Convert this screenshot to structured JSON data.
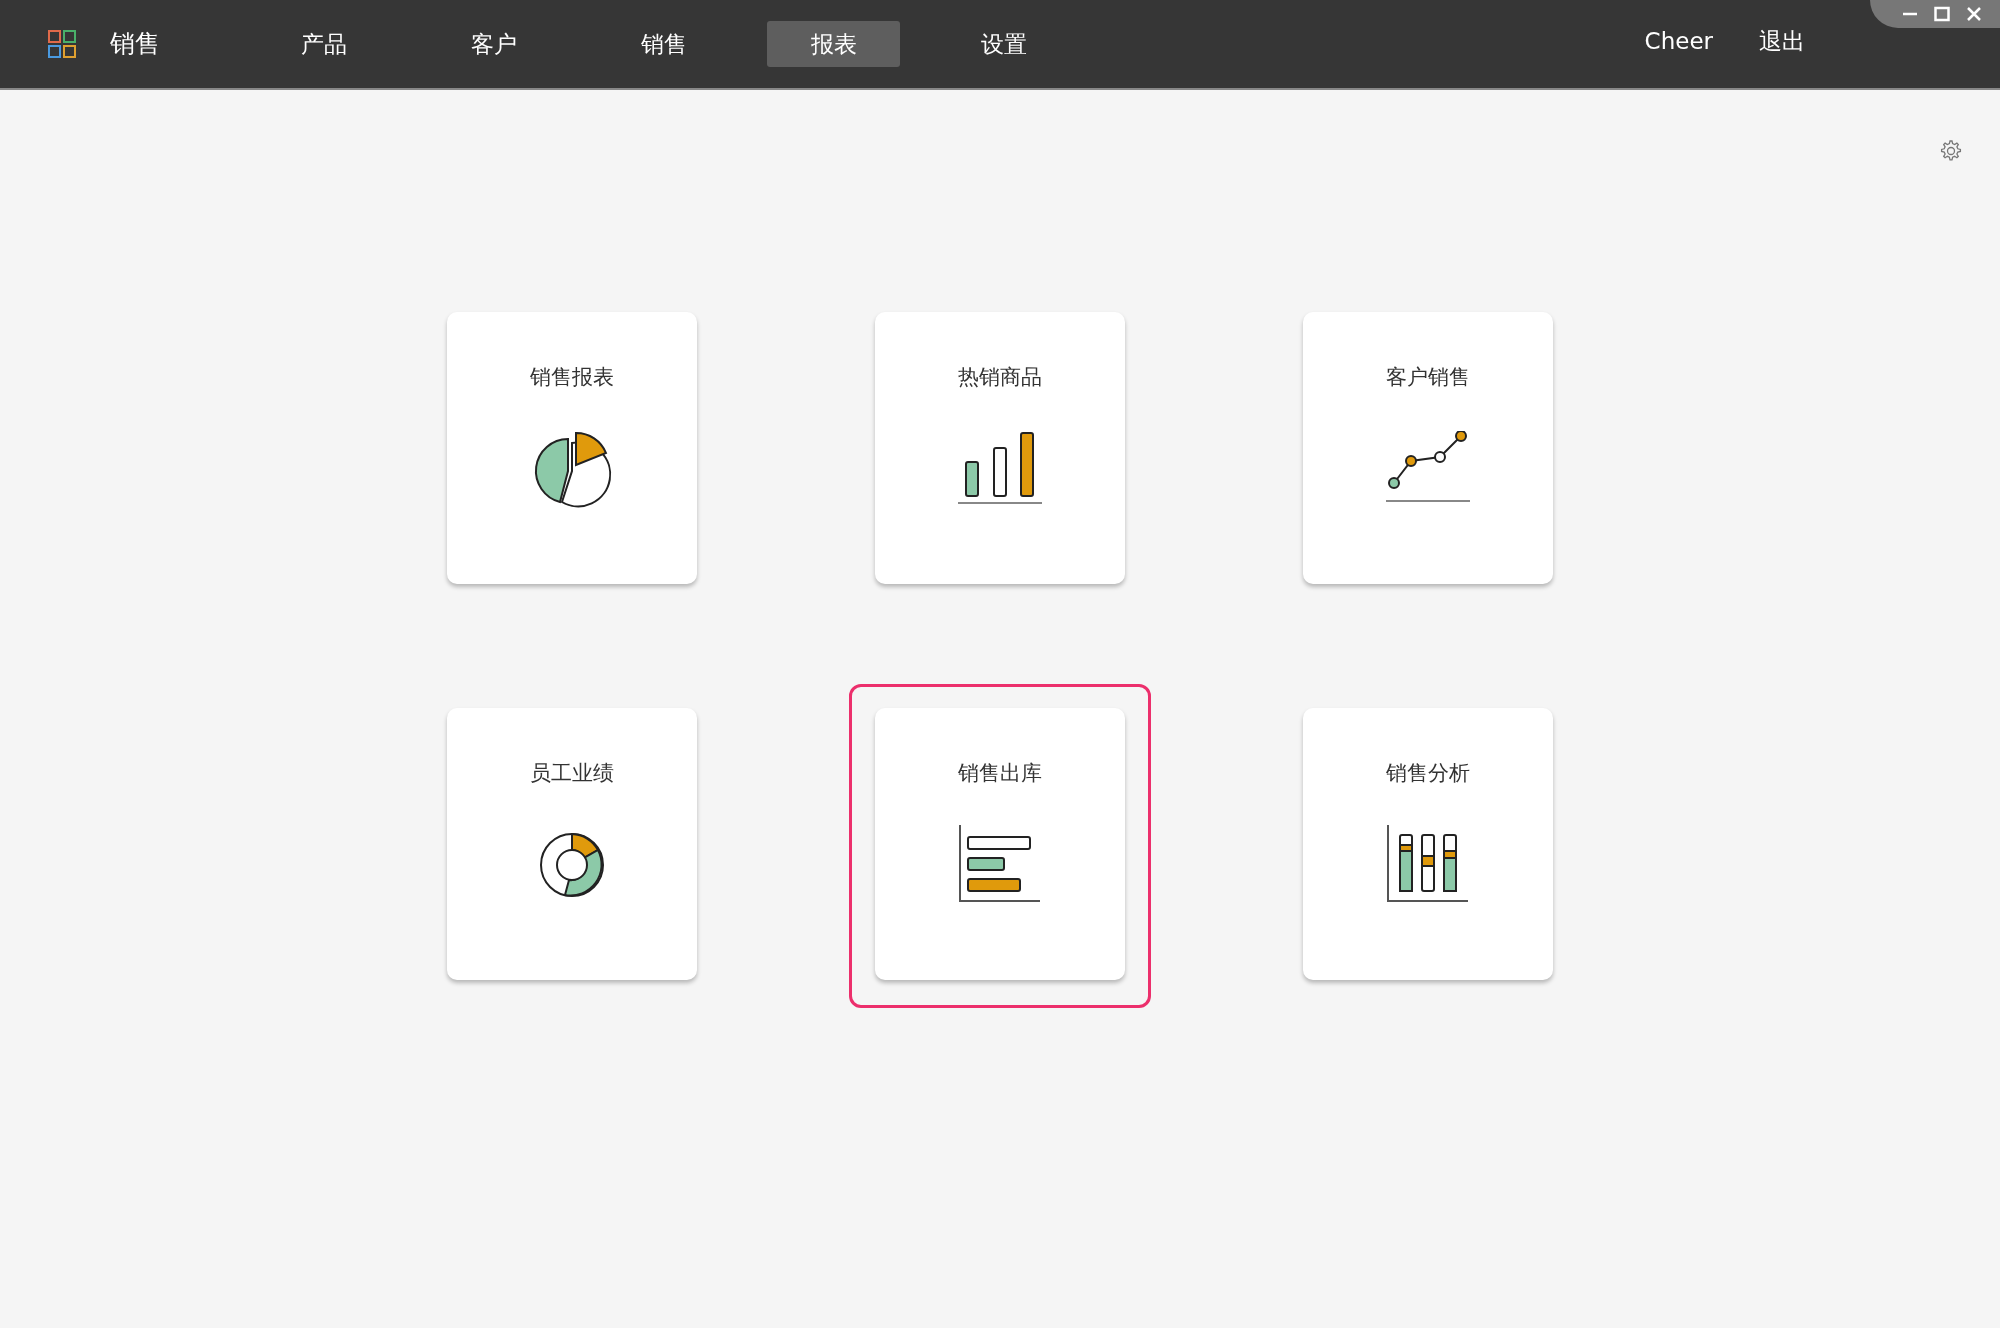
{
  "app": {
    "title": "销售"
  },
  "nav": [
    {
      "label": "产品",
      "selected": false
    },
    {
      "label": "客户",
      "selected": false
    },
    {
      "label": "销售",
      "selected": false
    },
    {
      "label": "报表",
      "selected": true
    },
    {
      "label": "设置",
      "selected": false
    }
  ],
  "user": {
    "name": "Cheer",
    "logout": "退出"
  },
  "reports": [
    {
      "title": "销售报表",
      "kind": "pie",
      "selected": false
    },
    {
      "title": "热销商品",
      "kind": "bar",
      "selected": false
    },
    {
      "title": "客户销售",
      "kind": "line",
      "selected": false
    },
    {
      "title": "员工业绩",
      "kind": "donut",
      "selected": false
    },
    {
      "title": "销售出库",
      "kind": "hbar",
      "selected": true
    },
    {
      "title": "销售分析",
      "kind": "stacked",
      "selected": false
    }
  ]
}
